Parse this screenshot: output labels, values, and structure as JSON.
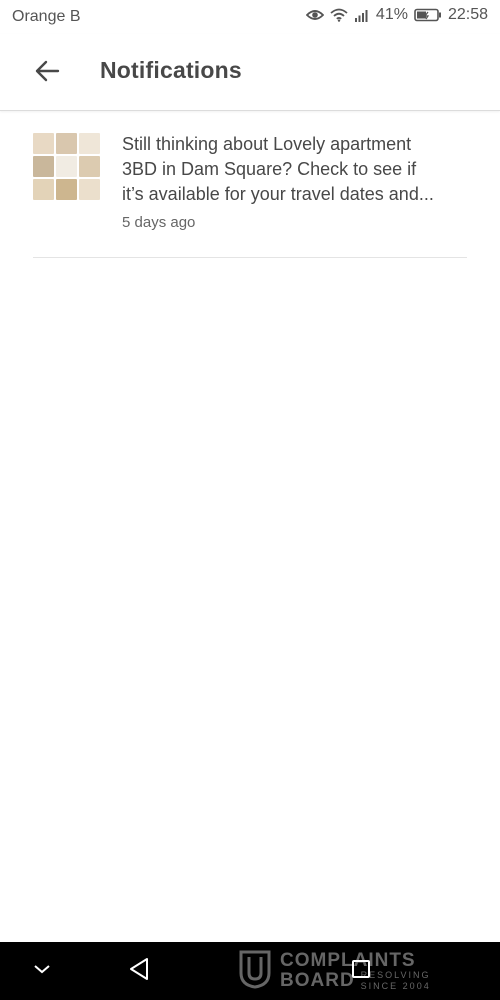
{
  "status_bar": {
    "carrier": "Orange B",
    "battery_percent": "41%",
    "time": "22:58"
  },
  "header": {
    "title": "Notifications"
  },
  "notifications": [
    {
      "lines": [
        "Still thinking about Lovely apartment",
        "3BD in Dam Square? Check to see if",
        "it’s available for your travel dates and..."
      ],
      "time_ago": "5 days ago"
    }
  ],
  "watermark": {
    "line1": "COMPLAINTS",
    "line2": "BOARD",
    "tag1": "RESOLVING",
    "tag2": "SINCE 2004"
  },
  "colors": {
    "title_text": "#484848",
    "body_text": "#484848",
    "secondary_text": "#666666",
    "nav_bar": "#000000"
  }
}
